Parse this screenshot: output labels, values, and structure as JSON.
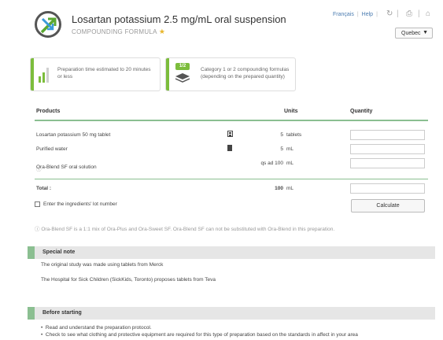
{
  "header": {
    "title": "Losartan potassium 2.5 mg/mL oral suspension",
    "subtitle": "COMPOUNDING FORMULA",
    "links": [
      "Français",
      "Help"
    ],
    "region_select": "Quebec"
  },
  "info": {
    "prep_time": "Preparation time estimated to 20 minutes or less",
    "category_badge": "1/2",
    "category": "Category 1 or 2 compounding formulas (depending on the prepared quantity)"
  },
  "table": {
    "headers": {
      "products": "Products",
      "units": "Units",
      "quantity": "Quantity"
    },
    "rows": [
      {
        "product": "Losartan potassium 50 mg tablet",
        "amount": "5",
        "unit": "tablets"
      },
      {
        "product": "Purified water",
        "amount": "5",
        "unit": "mL"
      },
      {
        "product": "Ora-Blend SF oral solution",
        "amount": "qs ad 100",
        "unit": "mL"
      }
    ],
    "total_label": "Total :",
    "total_amount": "100",
    "total_unit": "mL"
  },
  "lot_checkbox_label": "Enter the ingredients' lot number",
  "calculate_label": "Calculate",
  "footnote": "Ora-Blend SF is a 1:1 mix of Ora-Plus and Ora-Sweet SF. Ora-Blend SF can not be substituted with Ora-Blend in this preparation.",
  "special_note": {
    "title": "Special note",
    "lines": [
      "The original study was made using tablets from Merck",
      "The Hospital for Sick Children (SickKids, Toronto) proposes tablets from Teva"
    ]
  },
  "before_starting": {
    "title": "Before starting",
    "items": [
      "Read and understand the preparation protocol.",
      "Check to see what clothing and protective equipment are required for this type of preparation based on the standards in affect in your area"
    ]
  },
  "colors": {
    "accent_green": "#7cbd3c",
    "section_green": "#8bbf91",
    "link_blue": "#4a7bb0"
  }
}
